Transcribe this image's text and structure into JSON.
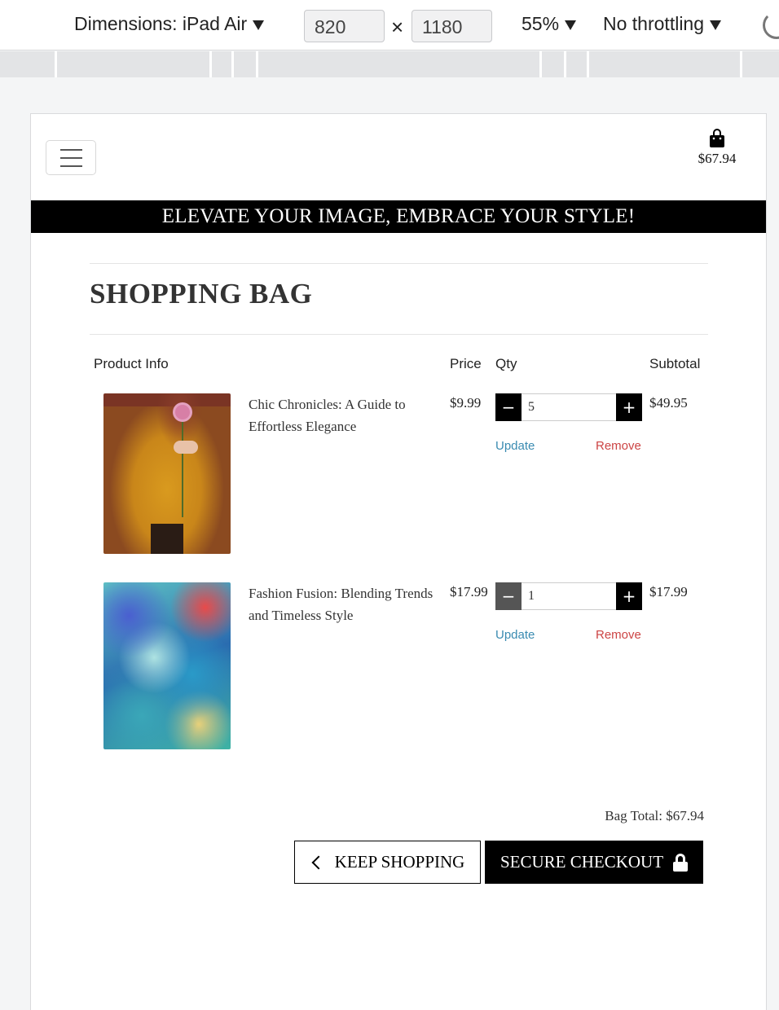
{
  "devtools": {
    "dimensions_label": "Dimensions: iPad Air",
    "width_value": "820",
    "times": "×",
    "height_value": "1180",
    "zoom": "55%",
    "throttling": "No throttling"
  },
  "nav": {
    "bag_total": "$67.94"
  },
  "banner": {
    "text": "ELEVATE YOUR IMAGE, EMBRACE YOUR STYLE!"
  },
  "page": {
    "title": "SHOPPING BAG"
  },
  "table": {
    "headers": {
      "product": "Product Info",
      "price": "Price",
      "qty": "Qty",
      "subtotal": "Subtotal"
    },
    "rows": [
      {
        "name": "Chic Chronicles: A Guide to Effortless Elegance",
        "price": "$9.99",
        "qty": "5",
        "subtotal": "$49.95",
        "update": "Update",
        "remove": "Remove"
      },
      {
        "name": "Fashion Fusion: Blending Trends and Timeless Style",
        "price": "$17.99",
        "qty": "1",
        "subtotal": "$17.99",
        "update": "Update",
        "remove": "Remove"
      }
    ]
  },
  "summary": {
    "bag_total": "Bag Total: $67.94"
  },
  "buttons": {
    "keep_shopping": "KEEP SHOPPING",
    "secure_checkout": "SECURE CHECKOUT",
    "minus": "−",
    "plus": "+"
  }
}
